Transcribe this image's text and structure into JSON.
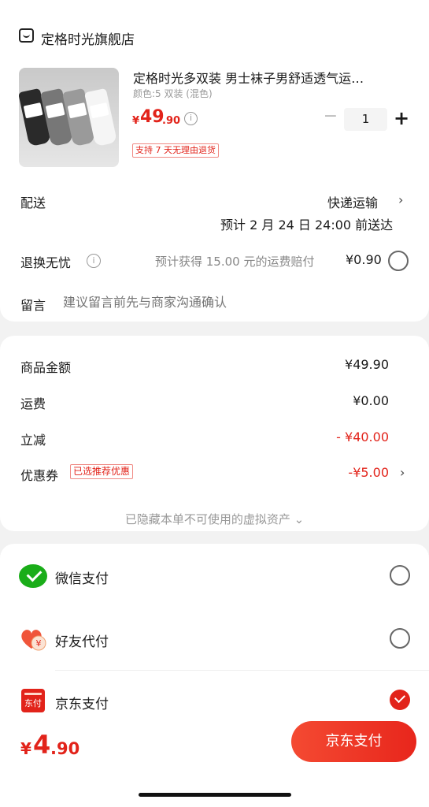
{
  "shop": {
    "name": "定格时光旗舰店"
  },
  "product": {
    "title": "定格时光多双装 男士袜子男舒适透气运…",
    "spec": "颜色:5 双装 (混色)",
    "price_symbol": "¥",
    "price_int": "49",
    "price_dec": ".90",
    "quantity": "1",
    "return_badge": "支持 7 天无理由退货",
    "sock_colors": [
      "#2a2a2a",
      "#777777",
      "#9a9a9a",
      "#f5f5f5"
    ]
  },
  "delivery": {
    "label": "配送",
    "method": "快递运输",
    "eta": "预计 2 月 24 日 24:00 前送达"
  },
  "exchange": {
    "label": "退换无忧",
    "desc": "预计获得 15.00 元的运费赔付",
    "price": "¥0.90"
  },
  "message": {
    "label": "留言",
    "placeholder": "建议留言前先与商家沟通确认"
  },
  "summary": {
    "goods_label": "商品金额",
    "goods_value": "¥49.90",
    "shipping_label": "运费",
    "shipping_value": "¥0.00",
    "discount_label": "立减",
    "discount_value": "- ¥40.00",
    "coupon_label": "优惠券",
    "coupon_badge": "已选推荐优惠",
    "coupon_value": "-¥5.00",
    "hidden_assets": "已隐藏本单不可使用的虚拟资产 ⌄"
  },
  "payment": {
    "wechat": "微信支付",
    "friend": "好友代付",
    "jd": "京东支付",
    "jd_icon_text": "东付",
    "selected": "jd"
  },
  "footer": {
    "total_symbol": "¥",
    "total_int": "4",
    "total_dec": ".90",
    "pay_button": "京东支付"
  },
  "colors": {
    "accent": "#e2231a",
    "wechat": "#1aad19"
  }
}
